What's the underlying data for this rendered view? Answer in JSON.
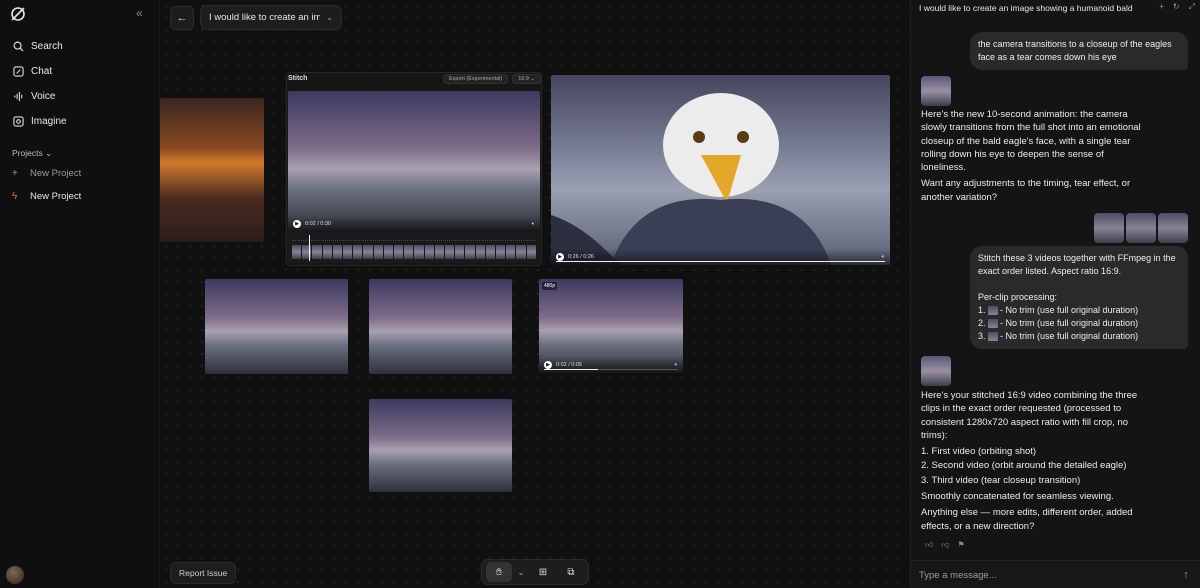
{
  "sidebar": {
    "logo_icon": "grok-logo-icon",
    "collapse_icon": "double-chevron-left-icon",
    "nav": [
      {
        "label": "Search",
        "icon": "search-icon"
      },
      {
        "label": "Chat",
        "icon": "chat-icon"
      },
      {
        "label": "Voice",
        "icon": "voice-icon"
      },
      {
        "label": "Imagine",
        "icon": "imagine-icon"
      }
    ],
    "projects_label": "Projects",
    "projects": [
      {
        "label": "New Project",
        "icon": "plus-icon"
      },
      {
        "label": "New Project",
        "icon": "flash-icon"
      }
    ]
  },
  "canvas": {
    "title": "I would like to create an image showing a humanoid bald eagle",
    "stitch_label": "Stitch",
    "export_label": "Export (Experimental)",
    "ratio_label": "16:9",
    "stitch_time": "0:02 / 0:30",
    "closeup_time": "0:26 / 0:26",
    "orbit_time": "0:02 / 0:05",
    "badge_480": "480p",
    "stitch_progress": 0.07,
    "closeup_progress": 1.0,
    "orbit_progress": 0.4,
    "report_label": "Report Issue",
    "tools": [
      "hand-tool-icon",
      "chevron-down-icon",
      "add-image-icon",
      "add-frame-icon"
    ]
  },
  "chat": {
    "title": "I would like to create an image showing a humanoid bald eagle",
    "msg1": "the camera transitions to a closeup of the eagles face as a tear comes down his eye",
    "ai1_p1": "Here's the new 10-second animation: the camera slowly transitions from the full shot into an emotional closeup of the bald eagle's face, with a single tear rolling down his eye to deepen the sense of loneliness.",
    "ai1_p2": "Want any adjustments to the timing, tear effect, or another variation?",
    "msg2_line1": "Stitch these 3 videos together with FFmpeg in the exact order listed. Aspect ratio 16:9.",
    "msg2_line2": "Per-clip processing:",
    "msg2_items": [
      "- No trim (use full original duration)",
      "- No trim (use full original duration)",
      "- No trim (use full original duration)"
    ],
    "ai2_p1": "Here's your stitched 16:9 video combining the three clips in the exact order requested (processed to consistent 1280x720 aspect ratio with fill crop, no trims):",
    "ai2_list": [
      "1. First video (orbiting shot)",
      "2. Second video (orbit around the detailed eagle)",
      "3. Third video (tear closeup transition)"
    ],
    "ai2_p2": "Smoothly concatenated for seamless viewing.",
    "ai2_p3": "Anything else — more edits, different order, added effects, or a new direction?",
    "placeholder": "Type a message..."
  }
}
